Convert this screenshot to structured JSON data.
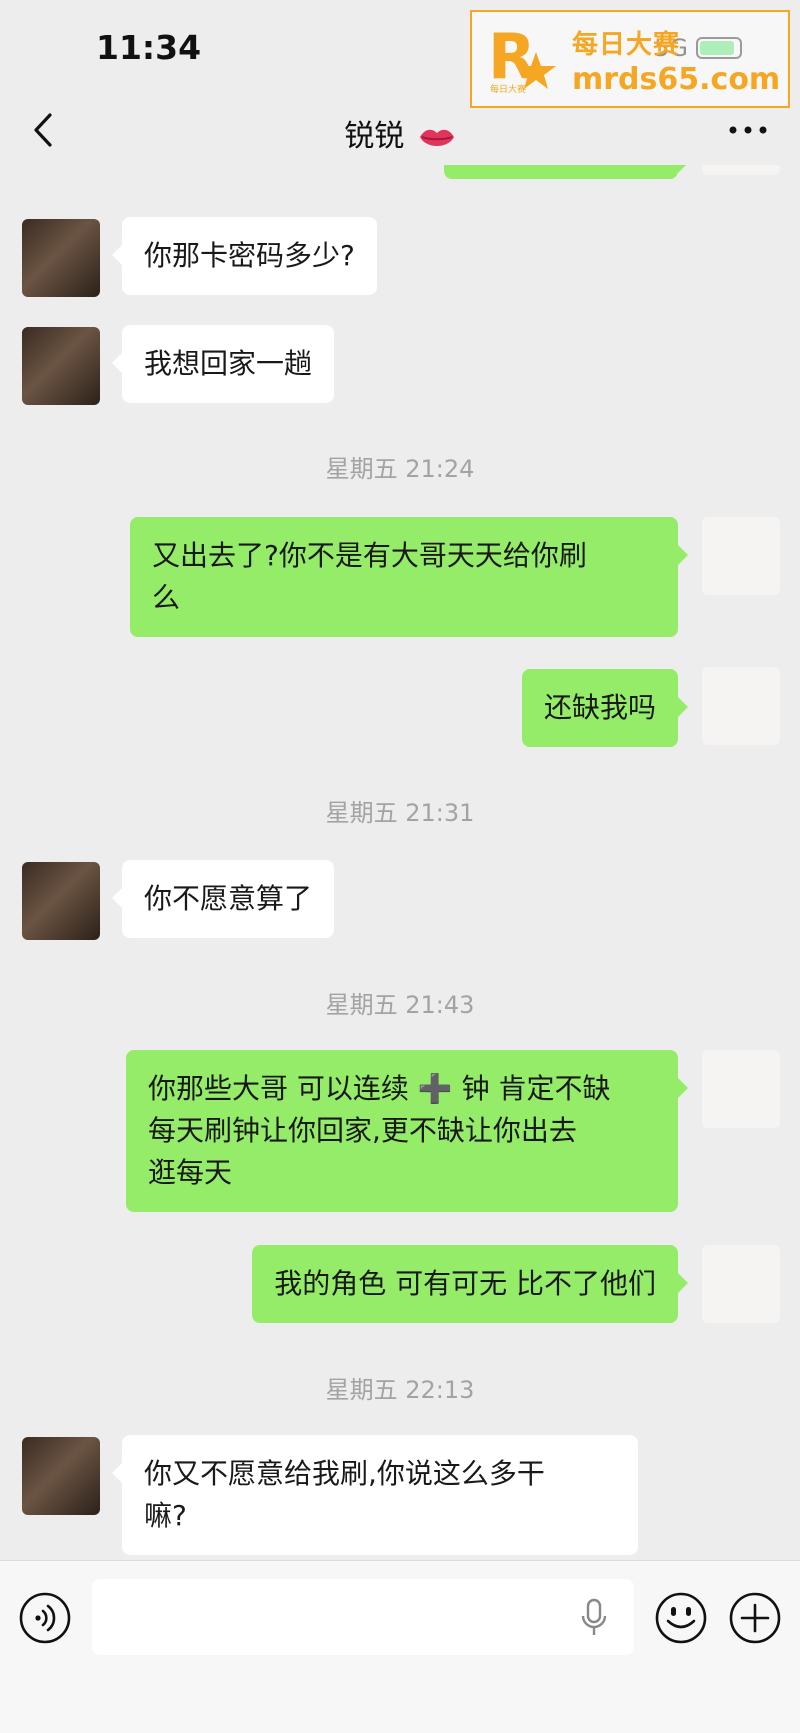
{
  "status_bar": {
    "time": "11:34",
    "signal": "5G"
  },
  "watermark": {
    "title": "每日大赛",
    "url": "mrds65.com",
    "logo_sub": "每日大赛"
  },
  "nav": {
    "title": "锐锐"
  },
  "timestamps": [
    "星期五 21:24",
    "星期五 21:31",
    "星期五 21:43",
    "星期五 22:13"
  ],
  "messages": [
    {
      "side": "in",
      "text": "你那卡密码多少?"
    },
    {
      "side": "in",
      "text": "我想回家一趟"
    },
    {
      "side": "out",
      "text": "又出去了?你不是有大哥天天给你刷\n么"
    },
    {
      "side": "out",
      "text": "还缺我吗"
    },
    {
      "side": "in",
      "text": "你不愿意算了"
    },
    {
      "side": "out",
      "text": "你那些大哥 可以连续 ➕ 钟 肯定不缺\n每天刷钟让你回家,更不缺让你出去\n逛每天"
    },
    {
      "side": "out",
      "text": "我的角色 可有可无 比不了他们"
    },
    {
      "side": "in",
      "text": "你又不愿意给我刷,你说这么多干\n嘛?"
    }
  ],
  "input": {
    "value": "",
    "placeholder": ""
  },
  "colors": {
    "outgoing_bubble": "#95ec69",
    "incoming_bubble": "#ffffff",
    "background": "#ededed",
    "watermark": "#f5a623"
  },
  "icons": [
    "back-arrow-icon",
    "lips-icon",
    "more-dots-icon",
    "voice-icon",
    "microphone-icon",
    "emoji-icon",
    "plus-icon"
  ]
}
